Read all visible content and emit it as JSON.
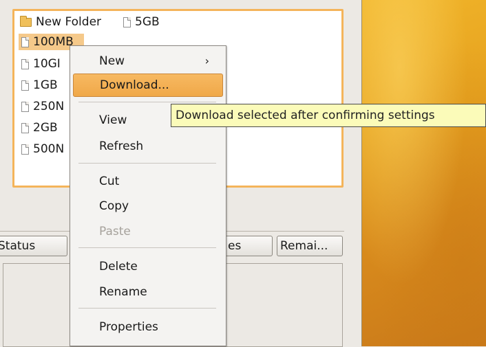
{
  "tree": {
    "items": [
      {
        "label": "New Folder",
        "icon": "folder-icon"
      },
      {
        "label": "5GB",
        "icon": "file-icon"
      },
      {
        "label": "100MB",
        "icon": "file-icon",
        "selected": true
      },
      {
        "label": "10GI",
        "icon": "file-icon"
      },
      {
        "label": "1GB",
        "icon": "file-icon"
      },
      {
        "label": "250N",
        "icon": "file-icon"
      },
      {
        "label": "2GB",
        "icon": "file-icon"
      },
      {
        "label": "500N",
        "icon": "file-icon"
      }
    ]
  },
  "list": {
    "columns": [
      "Status",
      "es",
      "Remai..."
    ]
  },
  "context_menu": {
    "items": {
      "new": "New",
      "download": "Download...",
      "view": "View",
      "refresh": "Refresh",
      "cut": "Cut",
      "copy": "Copy",
      "paste": "Paste",
      "delete": "Delete",
      "rename": "Rename",
      "properties": "Properties"
    },
    "submenu_arrow": "›",
    "highlighted": "download",
    "disabled": [
      "paste"
    ]
  },
  "tooltip": {
    "text": "Download selected after confirming settings"
  },
  "colors": {
    "selection": "#f5c98a",
    "highlight": "#f0a848",
    "tooltip_bg": "#fbfbb9",
    "desktop": "#e6a21f"
  }
}
